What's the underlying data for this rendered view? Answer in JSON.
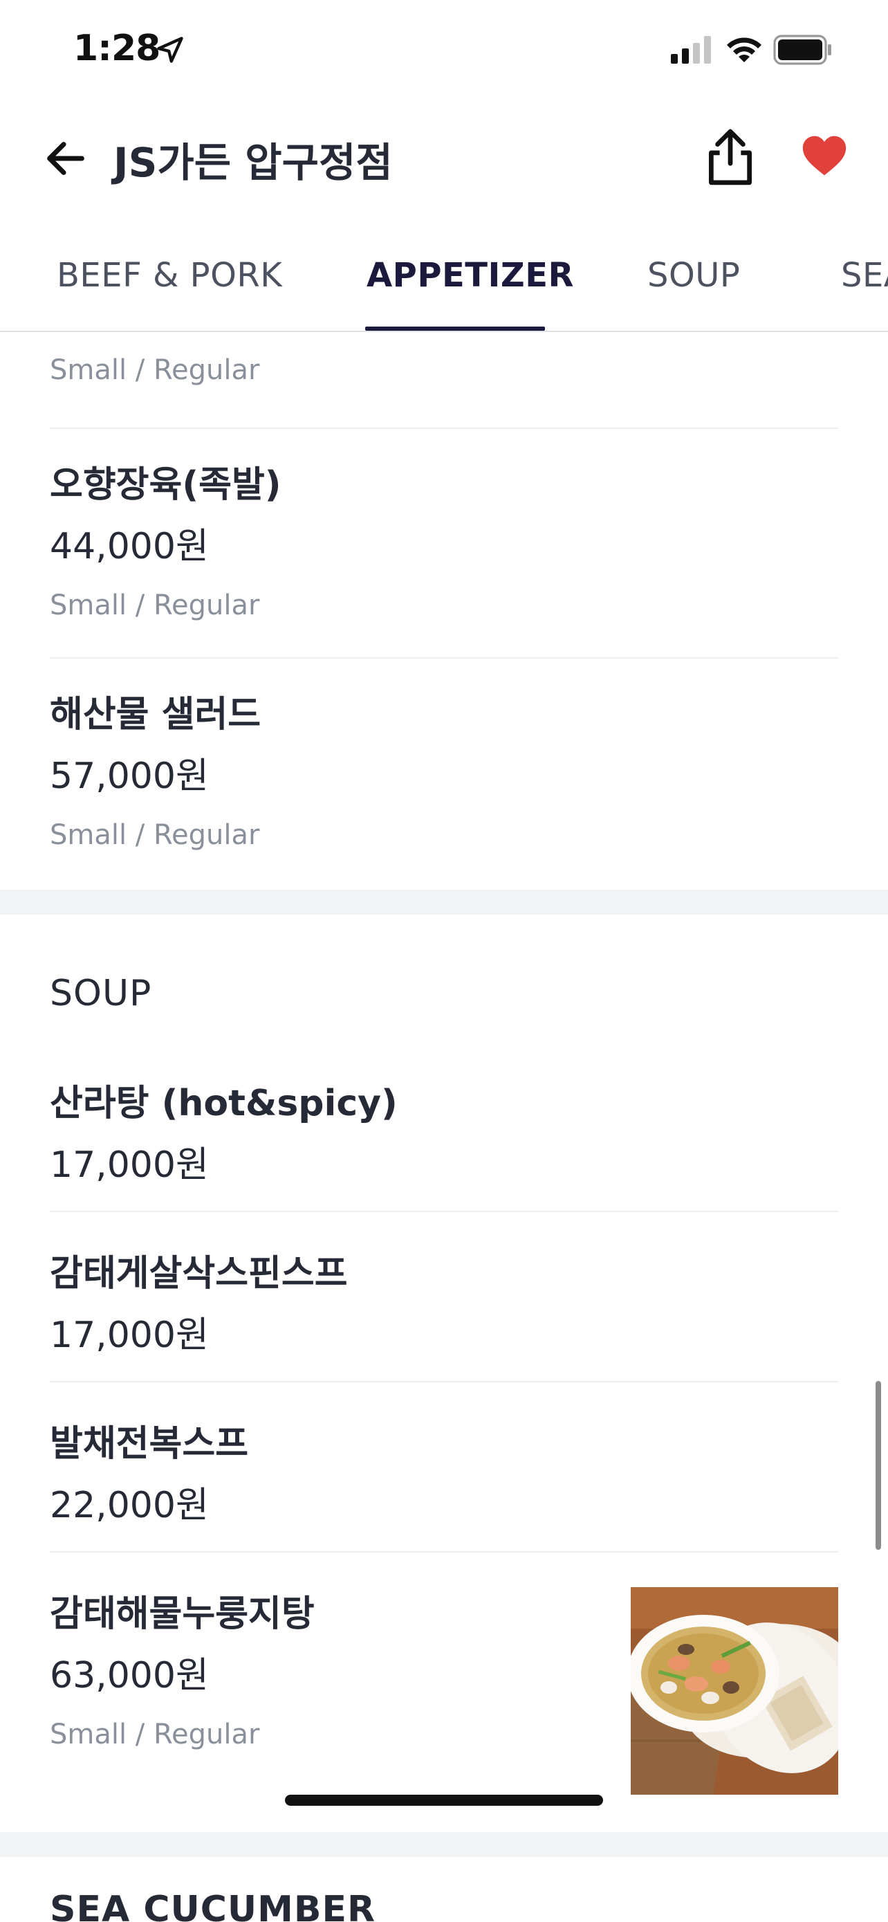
{
  "status_bar": {
    "time": "1:28",
    "icons": [
      "location-arrow-icon",
      "cellular-signal-icon",
      "wifi-icon",
      "battery-icon"
    ]
  },
  "header": {
    "title": "JS가든 압구정점",
    "icons": [
      "back-arrow-icon",
      "share-icon",
      "heart-icon"
    ],
    "heart_color": "#e0413a"
  },
  "tabs": [
    {
      "label": "BEEF & PORK",
      "active": false
    },
    {
      "label": "APPETIZER",
      "active": true
    },
    {
      "label": "SOUP",
      "active": false
    },
    {
      "label": "SEA",
      "active": false
    }
  ],
  "appetizer_items": [
    {
      "option": "Small / Regular"
    },
    {
      "name": "오향장육(족발)",
      "price": "44,000원",
      "option": "Small / Regular"
    },
    {
      "name": "해산물 샐러드",
      "price": "57,000원",
      "option": "Small / Regular"
    }
  ],
  "soup_section": {
    "title": "SOUP",
    "items": [
      {
        "name": "산라탕 (hot&spicy)",
        "price": "17,000원"
      },
      {
        "name": "감태게살삭스핀스프",
        "price": "17,000원"
      },
      {
        "name": "발채전복스프",
        "price": "22,000원"
      },
      {
        "name": "감태해물누룽지탕",
        "price": "63,000원",
        "option": "Small / Regular",
        "image": "seafood-rice-crust-soup-photo"
      }
    ]
  },
  "next_section_title": "SEA CUCUMBER",
  "colors": {
    "text_primary": "#262a36",
    "text_secondary": "#8a909b",
    "active_tab": "#1b1a3d",
    "section_gap": "#f2f3f5"
  }
}
